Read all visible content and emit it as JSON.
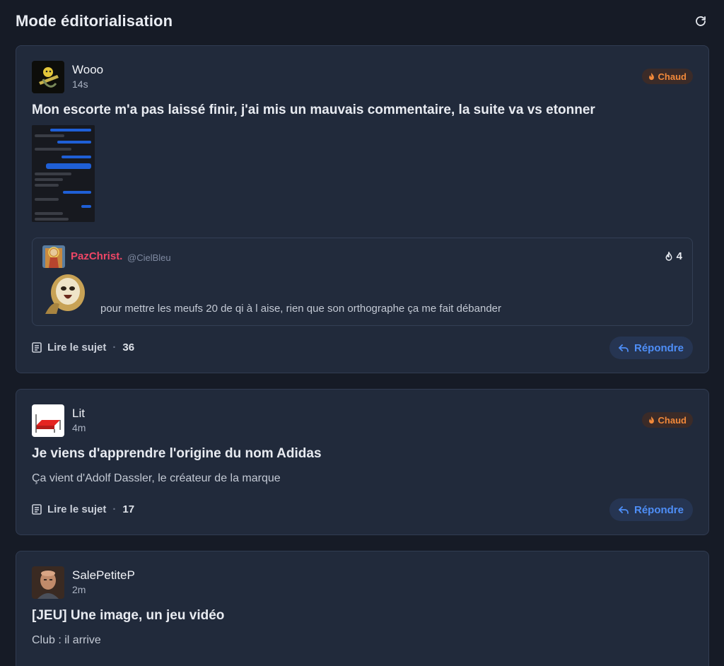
{
  "header": {
    "title": "Mode éditorialisation",
    "refresh_icon": "refresh-icon"
  },
  "colors": {
    "accent": "#4e8ef7",
    "hot": "#f2893a",
    "quote_author": "#ef4666",
    "background": "#161b26",
    "card": "#212a3b"
  },
  "posts": [
    {
      "author": "Wooo",
      "time": "14s",
      "badge": "Chaud",
      "title": "Mon escorte m'a pas laissé finir, j'ai mis un mauvais commentaire, la suite va vs etonner",
      "quote": {
        "author": "PazChrist.",
        "handle": "@CielBleu",
        "likes": "4",
        "text": "pour mettre les meufs 20 de qi à l aise, rien que son orthographe ça me fait débander"
      },
      "read_label": "Lire le sujet",
      "count": "36",
      "reply_label": "Répondre"
    },
    {
      "author": "Lit",
      "time": "4m",
      "badge": "Chaud",
      "title": "Je viens d'apprendre l'origine du nom Adidas",
      "body": "Ça vient d'Adolf Dassler, le créateur de la marque",
      "read_label": "Lire le sujet",
      "count": "17",
      "reply_label": "Répondre"
    },
    {
      "author": "SalePetiteP",
      "time": "2m",
      "title": "[JEU] Une image, un jeu vidéo",
      "body": "Club : il arrive"
    }
  ]
}
